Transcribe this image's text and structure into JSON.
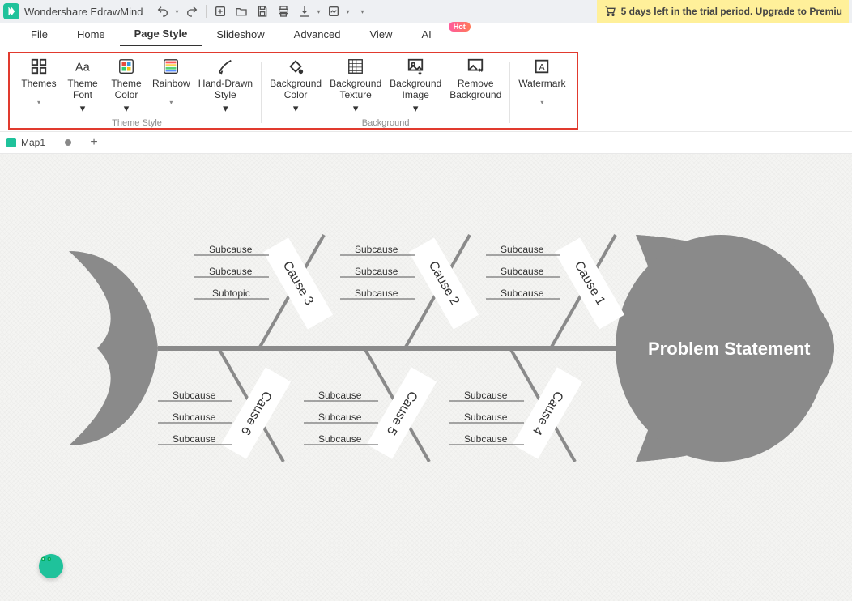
{
  "app": {
    "title": "Wondershare EdrawMind"
  },
  "trial": {
    "text": "5 days left in the trial period. Upgrade to Premiu"
  },
  "menu": {
    "file": "File",
    "home": "Home",
    "page_style": "Page Style",
    "slideshow": "Slideshow",
    "advanced": "Advanced",
    "view": "View",
    "ai": "AI",
    "ai_badge": "Hot"
  },
  "ribbon": {
    "themes": "Themes",
    "theme_font": "Theme\nFont",
    "theme_color": "Theme\nColor",
    "rainbow": "Rainbow",
    "hand_drawn": "Hand-Drawn\nStyle",
    "bg_color": "Background\nColor",
    "bg_texture": "Background\nTexture",
    "bg_image": "Background\nImage",
    "remove_bg": "Remove\nBackground",
    "watermark": "Watermark",
    "group_theme": "Theme Style",
    "group_bg": "Background"
  },
  "doc": {
    "tab1": "Map1"
  },
  "fishbone": {
    "head": "Problem Statement",
    "causes": [
      {
        "label": "Cause 3",
        "subs": [
          "Subcause",
          "Subcause",
          "Subtopic"
        ]
      },
      {
        "label": "Cause 2",
        "subs": [
          "Subcause",
          "Subcause",
          "Subcause"
        ]
      },
      {
        "label": "Cause 1",
        "subs": [
          "Subcause",
          "Subcause",
          "Subcause"
        ]
      },
      {
        "label": "Cause 6",
        "subs": [
          "Subcause",
          "Subcause",
          "Subcause"
        ]
      },
      {
        "label": "Cause 5",
        "subs": [
          "Subcause",
          "Subcause",
          "Subcause"
        ]
      },
      {
        "label": "Cause 4",
        "subs": [
          "Subcause",
          "Subcause",
          "Subcause"
        ]
      }
    ]
  }
}
